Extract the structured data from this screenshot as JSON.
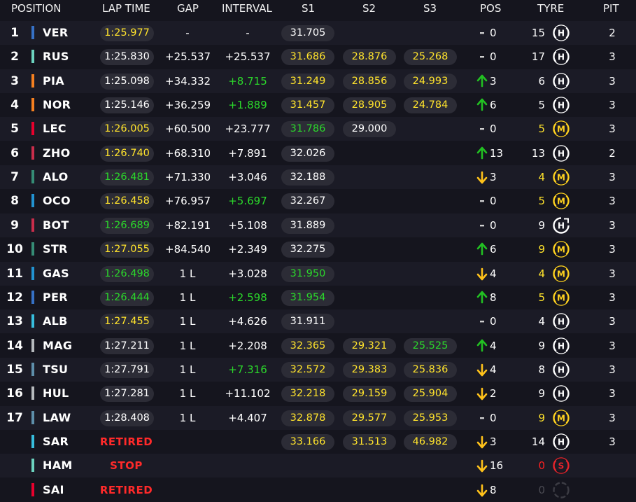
{
  "header": {
    "position": "POSITION",
    "lap_time": "LAP TIME",
    "gap": "GAP",
    "interval": "INTERVAL",
    "s1": "S1",
    "s2": "S2",
    "s3": "S3",
    "pos": "POS",
    "tyre": "TYRE",
    "pit": "PIT"
  },
  "colors": {
    "background": "#15151e",
    "row_alt": "#1b1b26",
    "pill": "#2c2c36",
    "yellow": "#ffe32c",
    "green": "#2bd82b",
    "red": "#ff2020",
    "hard_tyre": "#ffffff",
    "medium_tyre": "#ffd21f",
    "soft_tyre": "#e8242b"
  },
  "rows": [
    {
      "pos": "1",
      "team_color": "#3671c6",
      "driver": "VER",
      "lap": "1:25.977",
      "lap_color": "yellow",
      "gap": "-",
      "interval": "-",
      "int_color": "white",
      "s1": "31.705",
      "s1_color": "white",
      "s2": "",
      "s2_color": "white",
      "s3": "",
      "s3_color": "white",
      "change_dir": "none",
      "change": "0",
      "tyre_laps": "15",
      "tyre_laps_color": "white",
      "tyre": "H",
      "tyre_icon": "hard-tyre-icon",
      "tyre_color": "#ffffff",
      "pit": "2"
    },
    {
      "pos": "2",
      "team_color": "#6cd3bf",
      "driver": "RUS",
      "lap": "1:25.830",
      "lap_color": "white",
      "gap": "+25.537",
      "interval": "+25.537",
      "int_color": "white",
      "s1": "31.686",
      "s1_color": "yellow",
      "s2": "28.876",
      "s2_color": "yellow",
      "s3": "25.268",
      "s3_color": "yellow",
      "change_dir": "none",
      "change": "0",
      "tyre_laps": "17",
      "tyre_laps_color": "white",
      "tyre": "H",
      "tyre_icon": "hard-tyre-icon",
      "tyre_color": "#ffffff",
      "pit": "3"
    },
    {
      "pos": "3",
      "team_color": "#f58020",
      "driver": "PIA",
      "lap": "1:25.098",
      "lap_color": "white",
      "gap": "+34.332",
      "interval": "+8.715",
      "int_color": "green",
      "s1": "31.249",
      "s1_color": "yellow",
      "s2": "28.856",
      "s2_color": "yellow",
      "s3": "24.993",
      "s3_color": "yellow",
      "change_dir": "up",
      "change": "3",
      "tyre_laps": "6",
      "tyre_laps_color": "white",
      "tyre": "H",
      "tyre_icon": "hard-tyre-icon",
      "tyre_color": "#ffffff",
      "pit": "3"
    },
    {
      "pos": "4",
      "team_color": "#f58020",
      "driver": "NOR",
      "lap": "1:25.146",
      "lap_color": "white",
      "gap": "+36.259",
      "interval": "+1.889",
      "int_color": "green",
      "s1": "31.457",
      "s1_color": "yellow",
      "s2": "28.905",
      "s2_color": "yellow",
      "s3": "24.784",
      "s3_color": "yellow",
      "change_dir": "up",
      "change": "6",
      "tyre_laps": "5",
      "tyre_laps_color": "white",
      "tyre": "H",
      "tyre_icon": "hard-tyre-icon",
      "tyre_color": "#ffffff",
      "pit": "3"
    },
    {
      "pos": "5",
      "team_color": "#e8002d",
      "driver": "LEC",
      "lap": "1:26.005",
      "lap_color": "yellow",
      "gap": "+60.500",
      "interval": "+23.777",
      "int_color": "white",
      "s1": "31.786",
      "s1_color": "green",
      "s2": "29.000",
      "s2_color": "white",
      "s3": "",
      "s3_color": "white",
      "change_dir": "none",
      "change": "0",
      "tyre_laps": "5",
      "tyre_laps_color": "yellow",
      "tyre": "M",
      "tyre_icon": "medium-tyre-icon",
      "tyre_color": "#ffd21f",
      "pit": "3"
    },
    {
      "pos": "6",
      "team_color": "#c92d4b",
      "driver": "ZHO",
      "lap": "1:26.740",
      "lap_color": "yellow",
      "gap": "+68.310",
      "interval": "+7.891",
      "int_color": "white",
      "s1": "32.026",
      "s1_color": "white",
      "s2": "",
      "s2_color": "white",
      "s3": "",
      "s3_color": "white",
      "change_dir": "up",
      "change": "13",
      "tyre_laps": "13",
      "tyre_laps_color": "white",
      "tyre": "H",
      "tyre_icon": "hard-tyre-icon",
      "tyre_color": "#ffffff",
      "pit": "2"
    },
    {
      "pos": "7",
      "team_color": "#358c75",
      "driver": "ALO",
      "lap": "1:26.481",
      "lap_color": "green",
      "gap": "+71.330",
      "interval": "+3.046",
      "int_color": "white",
      "s1": "32.188",
      "s1_color": "white",
      "s2": "",
      "s2_color": "white",
      "s3": "",
      "s3_color": "white",
      "change_dir": "down",
      "change": "3",
      "tyre_laps": "4",
      "tyre_laps_color": "yellow",
      "tyre": "M",
      "tyre_icon": "medium-tyre-icon",
      "tyre_color": "#ffd21f",
      "pit": "3"
    },
    {
      "pos": "8",
      "team_color": "#2293d1",
      "driver": "OCO",
      "lap": "1:26.458",
      "lap_color": "yellow",
      "gap": "+76.957",
      "interval": "+5.697",
      "int_color": "green",
      "s1": "32.267",
      "s1_color": "white",
      "s2": "",
      "s2_color": "white",
      "s3": "",
      "s3_color": "white",
      "change_dir": "none",
      "change": "0",
      "tyre_laps": "5",
      "tyre_laps_color": "yellow",
      "tyre": "M",
      "tyre_icon": "medium-tyre-icon",
      "tyre_color": "#ffd21f",
      "pit": "3"
    },
    {
      "pos": "9",
      "team_color": "#c92d4b",
      "driver": "BOT",
      "lap": "1:26.689",
      "lap_color": "green",
      "gap": "+82.191",
      "interval": "+5.108",
      "int_color": "white",
      "s1": "31.889",
      "s1_color": "white",
      "s2": "",
      "s2_color": "white",
      "s3": "",
      "s3_color": "white",
      "change_dir": "none",
      "change": "0",
      "tyre_laps": "9",
      "tyre_laps_color": "white",
      "tyre": "H",
      "tyre_icon": "hard-tyre-used-icon",
      "tyre_color": "#ffffff",
      "pit": "3"
    },
    {
      "pos": "10",
      "team_color": "#358c75",
      "driver": "STR",
      "lap": "1:27.055",
      "lap_color": "yellow",
      "gap": "+84.540",
      "interval": "+2.349",
      "int_color": "white",
      "s1": "32.275",
      "s1_color": "white",
      "s2": "",
      "s2_color": "white",
      "s3": "",
      "s3_color": "white",
      "change_dir": "up",
      "change": "6",
      "tyre_laps": "9",
      "tyre_laps_color": "yellow",
      "tyre": "M",
      "tyre_icon": "medium-tyre-icon",
      "tyre_color": "#ffd21f",
      "pit": "3"
    },
    {
      "pos": "11",
      "team_color": "#2293d1",
      "driver": "GAS",
      "lap": "1:26.498",
      "lap_color": "green",
      "gap": "1 L",
      "interval": "+3.028",
      "int_color": "white",
      "s1": "31.950",
      "s1_color": "green",
      "s2": "",
      "s2_color": "white",
      "s3": "",
      "s3_color": "white",
      "change_dir": "down",
      "change": "4",
      "tyre_laps": "4",
      "tyre_laps_color": "yellow",
      "tyre": "M",
      "tyre_icon": "medium-tyre-icon",
      "tyre_color": "#ffd21f",
      "pit": "3"
    },
    {
      "pos": "12",
      "team_color": "#3671c6",
      "driver": "PER",
      "lap": "1:26.444",
      "lap_color": "green",
      "gap": "1 L",
      "interval": "+2.598",
      "int_color": "green",
      "s1": "31.954",
      "s1_color": "green",
      "s2": "",
      "s2_color": "white",
      "s3": "",
      "s3_color": "white",
      "change_dir": "up",
      "change": "8",
      "tyre_laps": "5",
      "tyre_laps_color": "yellow",
      "tyre": "M",
      "tyre_icon": "medium-tyre-icon",
      "tyre_color": "#ffd21f",
      "pit": "3"
    },
    {
      "pos": "13",
      "team_color": "#37bedd",
      "driver": "ALB",
      "lap": "1:27.455",
      "lap_color": "yellow",
      "gap": "1 L",
      "interval": "+4.626",
      "int_color": "white",
      "s1": "31.911",
      "s1_color": "white",
      "s2": "",
      "s2_color": "white",
      "s3": "",
      "s3_color": "white",
      "change_dir": "none",
      "change": "0",
      "tyre_laps": "4",
      "tyre_laps_color": "white",
      "tyre": "H",
      "tyre_icon": "hard-tyre-icon",
      "tyre_color": "#ffffff",
      "pit": "3"
    },
    {
      "pos": "14",
      "team_color": "#b6babd",
      "driver": "MAG",
      "lap": "1:27.211",
      "lap_color": "white",
      "gap": "1 L",
      "interval": "+2.208",
      "int_color": "white",
      "s1": "32.365",
      "s1_color": "yellow",
      "s2": "29.321",
      "s2_color": "yellow",
      "s3": "25.525",
      "s3_color": "green",
      "change_dir": "up",
      "change": "4",
      "tyre_laps": "9",
      "tyre_laps_color": "white",
      "tyre": "H",
      "tyre_icon": "hard-tyre-icon",
      "tyre_color": "#ffffff",
      "pit": "3"
    },
    {
      "pos": "15",
      "team_color": "#5e8faa",
      "driver": "TSU",
      "lap": "1:27.791",
      "lap_color": "white",
      "gap": "1 L",
      "interval": "+7.316",
      "int_color": "green",
      "s1": "32.572",
      "s1_color": "yellow",
      "s2": "29.383",
      "s2_color": "yellow",
      "s3": "25.836",
      "s3_color": "yellow",
      "change_dir": "down",
      "change": "4",
      "tyre_laps": "8",
      "tyre_laps_color": "white",
      "tyre": "H",
      "tyre_icon": "hard-tyre-icon",
      "tyre_color": "#ffffff",
      "pit": "3"
    },
    {
      "pos": "16",
      "team_color": "#b6babd",
      "driver": "HUL",
      "lap": "1:27.281",
      "lap_color": "white",
      "gap": "1 L",
      "interval": "+11.102",
      "int_color": "white",
      "s1": "32.218",
      "s1_color": "yellow",
      "s2": "29.159",
      "s2_color": "yellow",
      "s3": "25.904",
      "s3_color": "yellow",
      "change_dir": "down",
      "change": "2",
      "tyre_laps": "9",
      "tyre_laps_color": "white",
      "tyre": "H",
      "tyre_icon": "hard-tyre-icon",
      "tyre_color": "#ffffff",
      "pit": "3"
    },
    {
      "pos": "17",
      "team_color": "#5e8faa",
      "driver": "LAW",
      "lap": "1:28.408",
      "lap_color": "white",
      "gap": "1 L",
      "interval": "+4.407",
      "int_color": "white",
      "s1": "32.878",
      "s1_color": "yellow",
      "s2": "29.577",
      "s2_color": "yellow",
      "s3": "25.953",
      "s3_color": "yellow",
      "change_dir": "none",
      "change": "0",
      "tyre_laps": "9",
      "tyre_laps_color": "yellow",
      "tyre": "M",
      "tyre_icon": "medium-tyre-icon",
      "tyre_color": "#ffd21f",
      "pit": "3"
    },
    {
      "pos": "",
      "team_color": "#37bedd",
      "driver": "SAR",
      "status": "RETIRED",
      "gap": "",
      "interval": "",
      "int_color": "white",
      "s1": "33.166",
      "s1_color": "yellow",
      "s2": "31.513",
      "s2_color": "yellow",
      "s3": "46.982",
      "s3_color": "yellow",
      "change_dir": "down",
      "change": "3",
      "tyre_laps": "14",
      "tyre_laps_color": "white",
      "tyre": "H",
      "tyre_icon": "hard-tyre-icon",
      "tyre_color": "#ffffff",
      "pit": "3"
    },
    {
      "pos": "",
      "team_color": "#6cd3bf",
      "driver": "HAM",
      "status": "STOP",
      "gap": "",
      "interval": "",
      "int_color": "white",
      "s1": "",
      "s1_color": "white",
      "s2": "",
      "s2_color": "white",
      "s3": "",
      "s3_color": "white",
      "change_dir": "down",
      "change": "16",
      "tyre_laps": "0",
      "tyre_laps_color": "red",
      "tyre": "S",
      "tyre_icon": "soft-tyre-icon",
      "tyre_color": "#e8242b",
      "pit": ""
    },
    {
      "pos": "",
      "team_color": "#e8002d",
      "driver": "SAI",
      "status": "RETIRED",
      "gap": "",
      "interval": "",
      "int_color": "white",
      "s1": "",
      "s1_color": "white",
      "s2": "",
      "s2_color": "white",
      "s3": "",
      "s3_color": "white",
      "change_dir": "down",
      "change": "8",
      "tyre_laps": "0",
      "tyre_laps_color": "dim",
      "tyre": "",
      "tyre_icon": "unknown-tyre-icon",
      "tyre_color": "#3c3c44",
      "pit": ""
    }
  ]
}
